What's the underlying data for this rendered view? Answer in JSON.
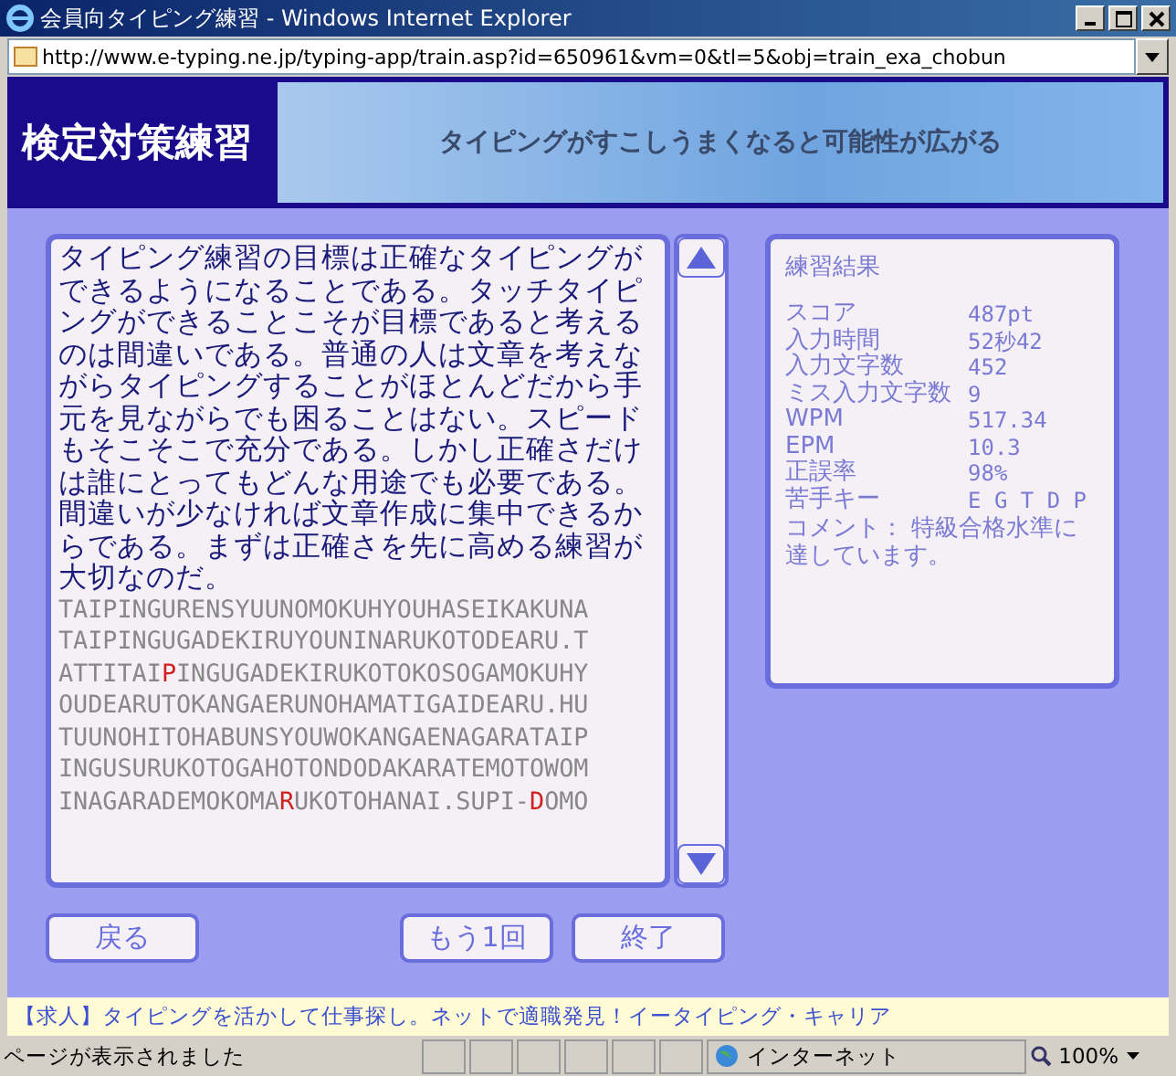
{
  "window": {
    "title": "会員向タイピング練習 - Windows Internet Explorer",
    "address": "http://www.e-typing.ne.jp/typing-app/train.asp?id=650961&vm=0&tl=5&obj=train_exa_chobun"
  },
  "header": {
    "title": "検定対策練習",
    "banner": "タイピングがすこしうまくなると可能性が広がる"
  },
  "passage": {
    "text": "タイピング練習の目標は正確なタイピングができるようになることである。タッチタイピングができることこそが目標であると考えるのは間違いである。普通の人は文章を考えながらタイピングすることがほとんどだから手元を見ながらでも困ることはない。スピードもそこそこで充分である。しかし正確さだけは誰にとってもどんな用途でも必要である。間違いが少なければ文章作成に集中できるからである。まずは正確さを先に高める練習が大切なのだ。",
    "romaji": [
      [
        {
          "text": "TAIPINGURENSYUUNOMOKUHYOUHASEIKAKUNA",
          "miss": false
        }
      ],
      [
        {
          "text": "TAIPINGUGADEKIRUYOUNINARUKOTODEARU.T",
          "miss": false
        }
      ],
      [
        {
          "text": "ATTITAI",
          "miss": false
        },
        {
          "text": "P",
          "miss": true
        },
        {
          "text": "INGUGADEKIRUKOTOKOSOGAMOKUHY",
          "miss": false
        }
      ],
      [
        {
          "text": "OUDEARUTOKANGAERUNOHAMATIGAIDEARU.HU",
          "miss": false
        }
      ],
      [
        {
          "text": "TUUNOHITOHABUNSYOUWOKANGAENAGARATAIP",
          "miss": false
        }
      ],
      [
        {
          "text": "INGUSURUKOTOGAHOTONDODAKARATEMOTOWOM",
          "miss": false
        }
      ],
      [
        {
          "text": "INAGARADEMOKOMA",
          "miss": false
        },
        {
          "text": "R",
          "miss": true
        },
        {
          "text": "UKOTOHANAI.SUPI-",
          "miss": false
        },
        {
          "text": "D",
          "miss": true
        },
        {
          "text": "OMO",
          "miss": false
        }
      ]
    ]
  },
  "results": {
    "title": "練習結果",
    "rows": [
      {
        "label": "スコア",
        "value": "487pt"
      },
      {
        "label": "入力時間",
        "value": "52秒42"
      },
      {
        "label": "入力文字数",
        "value": "452"
      },
      {
        "label": "ミス入力文字数",
        "value": "9"
      },
      {
        "label": "WPM",
        "value": "517.34"
      },
      {
        "label": "EPM",
        "value": "10.3"
      },
      {
        "label": "正誤率",
        "value": "98%"
      },
      {
        "label": "苦手キー",
        "value": "E G T D P"
      }
    ],
    "comment": "コメント： 特級合格水準に達しています。"
  },
  "buttons": [
    {
      "label": "戻る"
    },
    {
      "label": "もう1回"
    },
    {
      "label": "終了"
    }
  ],
  "ad": "【求人】タイピングを活かして仕事探し。ネットで適職発見！イータイピング・キャリア",
  "status_bar": {
    "message": "ページが表示されました",
    "zone": "インターネット",
    "zoom": "100%"
  }
}
